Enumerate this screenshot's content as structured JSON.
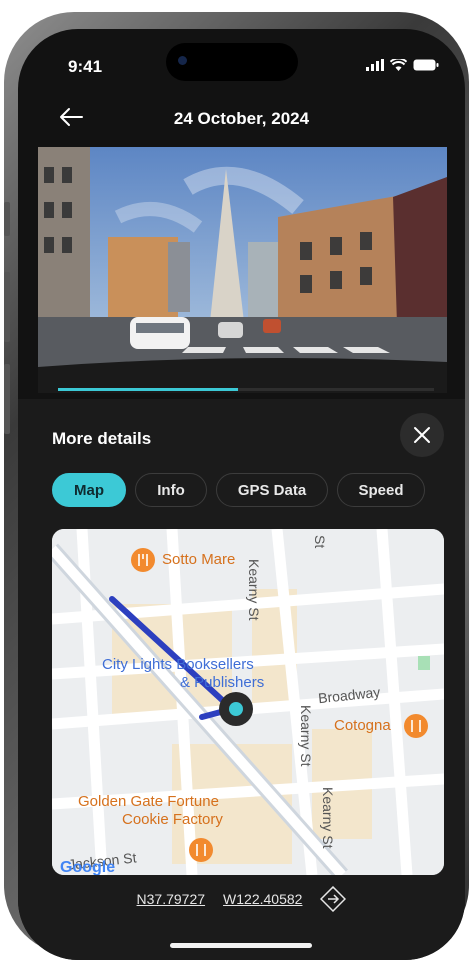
{
  "status_bar": {
    "time": "9:41"
  },
  "header": {
    "title": "24 October, 2024"
  },
  "video": {
    "progress": 0.48
  },
  "details": {
    "heading": "More details",
    "tabs": [
      {
        "label": "Map",
        "active": true
      },
      {
        "label": "Info",
        "active": false
      },
      {
        "label": "GPS Data",
        "active": false
      },
      {
        "label": "Speed",
        "active": false
      }
    ]
  },
  "map": {
    "streets": {
      "kearny": "Kearny St",
      "st": "St",
      "broadway": "Broadway",
      "jackson": "Jackson St"
    },
    "places": {
      "sotto_mare": "Sotto Mare",
      "city_lights": [
        "City Lights Booksellers",
        "& Publishers"
      ],
      "cotogna": "Cotogna",
      "golden_gate": [
        "Golden Gate Fortune",
        "Cookie Factory"
      ]
    },
    "logo": "Google"
  },
  "coordinates": {
    "lat": "N37.79727",
    "lon": "W122.40582"
  },
  "colors": {
    "accent": "#3cc9d6",
    "route": "#2c3fbf",
    "background": "#121212"
  }
}
